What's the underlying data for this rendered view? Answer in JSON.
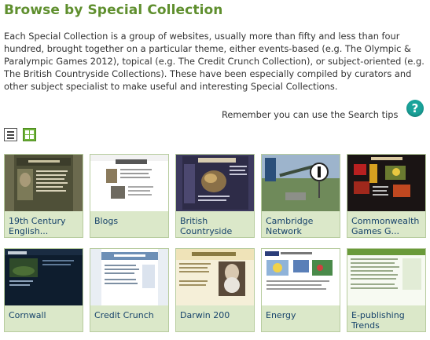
{
  "page": {
    "title": "Browse by Special Collection",
    "intro": "Each Special Collection is a group of websites, usually more than fifty and less than four hundred, brought together on a particular theme, either events-based (e.g. The Olympic & Paralympic Games 2012), topical (e.g. The Credit Crunch Collection), or subject-oriented (e.g. The British Countryside Collections). These have been especially compiled by curators and other subject specialist to make useful and interesting Special Collections.",
    "search_tips": "Remember you can use the Search tips",
    "help_icon_glyph": "?"
  },
  "view_toggle": {
    "list_icon": "list-view-icon",
    "grid_icon": "grid-view-icon",
    "active": "grid"
  },
  "colors": {
    "title": "#5f8f2e",
    "tile_bg": "#dbe8c9",
    "label": "#17436b",
    "help": "#1aa39a"
  },
  "collections": [
    {
      "label": "19th Century English..."
    },
    {
      "label": "Blogs"
    },
    {
      "label": "British Countryside"
    },
    {
      "label": "Cambridge Network"
    },
    {
      "label": "Commonwealth Games G..."
    },
    {
      "label": "Cornwall"
    },
    {
      "label": "Credit Crunch"
    },
    {
      "label": "Darwin 200"
    },
    {
      "label": "Energy"
    },
    {
      "label": "E-publishing Trends"
    }
  ]
}
